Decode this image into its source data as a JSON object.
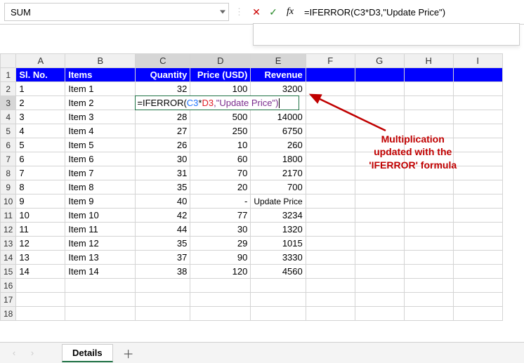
{
  "nameBox": "SUM",
  "formulaBar": "=IFERROR(C3*D3,\"Update Price\")",
  "columns": [
    "A",
    "B",
    "C",
    "D",
    "E",
    "F",
    "G",
    "H",
    "I"
  ],
  "activeCols": [
    "C",
    "D",
    "E"
  ],
  "activeRow": 3,
  "header": {
    "A": "Sl. No.",
    "B": "Items",
    "C": "Quantity",
    "D": "Price (USD)",
    "E": "Revenue"
  },
  "rows": [
    {
      "n": 1,
      "A": "1",
      "B": "Item 1",
      "C": "32",
      "D": "100",
      "E": "3200"
    },
    {
      "n": 2,
      "A": "2",
      "B": "Item 2",
      "C": "",
      "D": "",
      "E": "",
      "editing": true
    },
    {
      "n": 3,
      "A": "3",
      "B": "Item 3",
      "C": "28",
      "D": "500",
      "E": "14000"
    },
    {
      "n": 4,
      "A": "4",
      "B": "Item 4",
      "C": "27",
      "D": "250",
      "E": "6750"
    },
    {
      "n": 5,
      "A": "5",
      "B": "Item 5",
      "C": "26",
      "D": "10",
      "E": "260"
    },
    {
      "n": 6,
      "A": "6",
      "B": "Item 6",
      "C": "30",
      "D": "60",
      "E": "1800"
    },
    {
      "n": 7,
      "A": "7",
      "B": "Item 7",
      "C": "31",
      "D": "70",
      "E": "2170"
    },
    {
      "n": 8,
      "A": "8",
      "B": "Item 8",
      "C": "35",
      "D": "20",
      "E": "700"
    },
    {
      "n": 9,
      "A": "9",
      "B": "Item 9",
      "C": "40",
      "D": "-",
      "E": "Update Price"
    },
    {
      "n": 10,
      "A": "10",
      "B": "Item 10",
      "C": "42",
      "D": "77",
      "E": "3234"
    },
    {
      "n": 11,
      "A": "11",
      "B": "Item 11",
      "C": "44",
      "D": "30",
      "E": "1320"
    },
    {
      "n": 12,
      "A": "12",
      "B": "Item 12",
      "C": "35",
      "D": "29",
      "E": "1015"
    },
    {
      "n": 13,
      "A": "13",
      "B": "Item 13",
      "C": "37",
      "D": "90",
      "E": "3330"
    },
    {
      "n": 14,
      "A": "14",
      "B": "Item 14",
      "C": "38",
      "D": "120",
      "E": "4560"
    }
  ],
  "blankRows": [
    16,
    17,
    18
  ],
  "editFormula": {
    "prefix": "=IFERROR(",
    "ref1": "C3",
    "op": "*",
    "ref2": "D3",
    "suffix": ",\"Update Price\")"
  },
  "annotation": {
    "line1": "Multiplication",
    "line2": "updated with the",
    "line3": "'IFERROR' formula"
  },
  "sheetTab": "Details",
  "icons": {
    "cancel": "✕",
    "confirm": "✓",
    "fx": "fx",
    "plus": "＋",
    "prev": "‹",
    "next": "›"
  },
  "chart_data": {
    "type": "table",
    "title": "",
    "columns": [
      "Sl. No.",
      "Items",
      "Quantity",
      "Price (USD)",
      "Revenue"
    ],
    "rows": [
      [
        1,
        "Item 1",
        32,
        100,
        3200
      ],
      [
        2,
        "Item 2",
        null,
        null,
        null
      ],
      [
        3,
        "Item 3",
        28,
        500,
        14000
      ],
      [
        4,
        "Item 4",
        27,
        250,
        6750
      ],
      [
        5,
        "Item 5",
        26,
        10,
        260
      ],
      [
        6,
        "Item 6",
        30,
        60,
        1800
      ],
      [
        7,
        "Item 7",
        31,
        70,
        2170
      ],
      [
        8,
        "Item 8",
        35,
        20,
        700
      ],
      [
        9,
        "Item 9",
        40,
        null,
        "Update Price"
      ],
      [
        10,
        "Item 10",
        42,
        77,
        3234
      ],
      [
        11,
        "Item 11",
        44,
        30,
        1320
      ],
      [
        12,
        "Item 12",
        35,
        29,
        1015
      ],
      [
        13,
        "Item 13",
        37,
        90,
        3330
      ],
      [
        14,
        "Item 14",
        38,
        120,
        4560
      ]
    ]
  }
}
